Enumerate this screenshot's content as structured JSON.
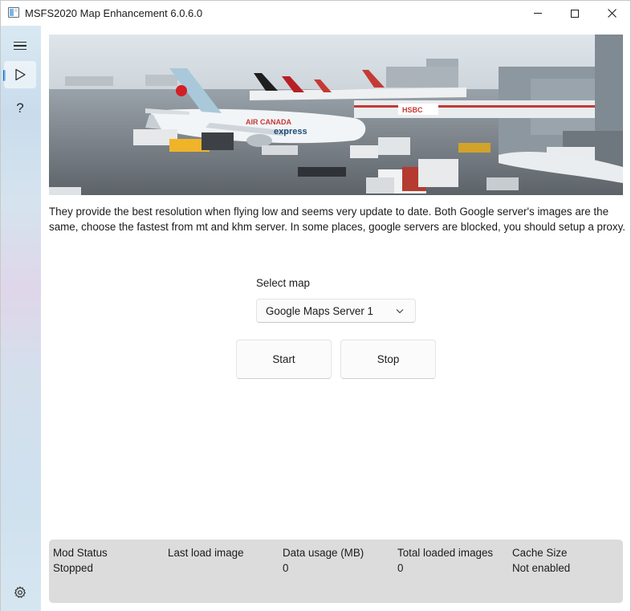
{
  "window": {
    "title": "MSFS2020 Map Enhancement 6.0.6.0",
    "controls": [
      "minimize",
      "maximize",
      "close"
    ]
  },
  "sidebar": {
    "items": [
      {
        "icon": "hamburger-menu-icon",
        "active": false
      },
      {
        "icon": "play-icon",
        "active": true
      },
      {
        "icon": "help-icon",
        "label": "?",
        "active": false
      },
      {
        "icon": "gear-icon",
        "active": false
      }
    ]
  },
  "main": {
    "hero_image": "airport-apron-photo",
    "description": "They provide the best resolution when flying low and seems very update to date. Both Google server's images are the same, choose the fastest from mt and khm server. In some places, google servers are blocked, you should setup a proxy.",
    "select_map": {
      "label": "Select map",
      "value": "Google Maps Server 1"
    },
    "buttons": {
      "start": "Start",
      "stop": "Stop"
    }
  },
  "status": {
    "columns": [
      {
        "header": "Mod Status",
        "value": "Stopped"
      },
      {
        "header": "Last load image",
        "value": ""
      },
      {
        "header": "Data usage (MB)",
        "value": "0"
      },
      {
        "header": "Total loaded images",
        "value": "0"
      },
      {
        "header": "Cache Size",
        "value": "Not enabled"
      }
    ]
  },
  "colors": {
    "accent": "#0067c0",
    "status_panel": "#dcdcdc"
  }
}
